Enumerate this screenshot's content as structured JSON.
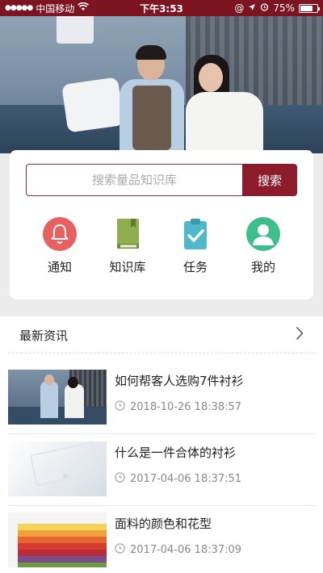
{
  "status_bar": {
    "carrier": "中国移动",
    "time": "下午3:53",
    "battery": "75%",
    "battery_level": 0.75
  },
  "search": {
    "placeholder": "搜索量品知识库",
    "button_label": "搜索"
  },
  "quick_actions": [
    {
      "label": "通知",
      "icon": "bell-icon",
      "color": "#e8605f"
    },
    {
      "label": "知识库",
      "icon": "book-icon",
      "color": "#8fae4e"
    },
    {
      "label": "任务",
      "icon": "clipboard-check-icon",
      "color": "#4fb9c9"
    },
    {
      "label": "我的",
      "icon": "user-icon",
      "color": "#3dbf8b"
    }
  ],
  "news": {
    "title": "最新资讯",
    "items": [
      {
        "title": "如何帮客人选购7件衬衫",
        "time": "2018-10-26 18:38:57"
      },
      {
        "title": "什么是一件合体的衬衫",
        "time": "2017-04-06 18:37:51"
      },
      {
        "title": "面料的颜色和花型",
        "time": "2017-04-06 18:37:09"
      }
    ]
  },
  "colors": {
    "brand": "#8c1c2b",
    "status_bar": "#7d1421"
  }
}
